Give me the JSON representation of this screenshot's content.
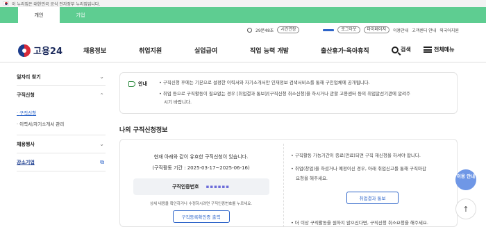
{
  "gov_banner": {
    "text": "이 누리집은 대한민국 공식 전자정부 누리집입니다."
  },
  "tabs": [
    {
      "label": "개인"
    },
    {
      "label": "기업"
    }
  ],
  "util": {
    "time_left": "29분48초",
    "extend_label": "시간연장",
    "logout_label": "로그아웃",
    "mypage_label": "마이페이지",
    "guide_label": "이용안내",
    "center_label": "고객센터 안내",
    "lang_label": "외국어지원"
  },
  "logo": {
    "name": "고용24"
  },
  "gnb": {
    "menus": [
      "채용정보",
      "취업지원",
      "실업급여",
      "직업 능력 개발",
      "출산휴가·육아휴직"
    ],
    "search_label": "검색",
    "allmenu_label": "전체메뉴"
  },
  "lnb": {
    "item1": "일자리 찾기",
    "item2": "구직신청",
    "sub1": "구직신청",
    "sub2": "이력서/자기소개서 관리",
    "item3": "채용행사",
    "item4": "강소기업"
  },
  "notice": {
    "label": "안내",
    "line1": "• 구직신청 후에는 기본으로 설정한 이력서와 자기소개서만 인재정보 검색서비스를 통해 구인업체에 공개됩니다.",
    "line2": "• 취업 등으로 구직활동이 필요없는 경우 [취업결과 통보]/[구직신청 취소신청]을 하시거나 관할 고용센터 등의 취업알선기관에 알려주",
    "line3": "시기 바랍니다."
  },
  "section": {
    "title": "나의 구직신청정보"
  },
  "status": {
    "line1": "현재 아래와 같이 유효한 구직신청이 있습니다.",
    "line2": "(구직활동 기간 : 2025-03-17~2025-06-16)",
    "id_label": "구직인증번호",
    "id_value": "▪▪▪▪▪▪",
    "line3": "상세 내용을 확인하거나 수정하시려면 구직인증번호를 누르세요.",
    "print_button": "구직등록확인증 출력"
  },
  "right": {
    "b1": "• 구직활동 가능기간이 종료(만료)되면 구직 재신청을 하셔야 합니다.",
    "b2": "• 취업(창업)을 하셨거나 예정이신 경우, 아래 취업신고를 통해 구직마감",
    "b3": "요청을 해주세요.",
    "result_button": "취업결과 통보",
    "b4": "• 더 이상 구직활동을 원하지 않으신다면, 구직신청 취소요청을 해주세요."
  },
  "fab": {
    "guide": "이용 안내",
    "top": "↑"
  }
}
